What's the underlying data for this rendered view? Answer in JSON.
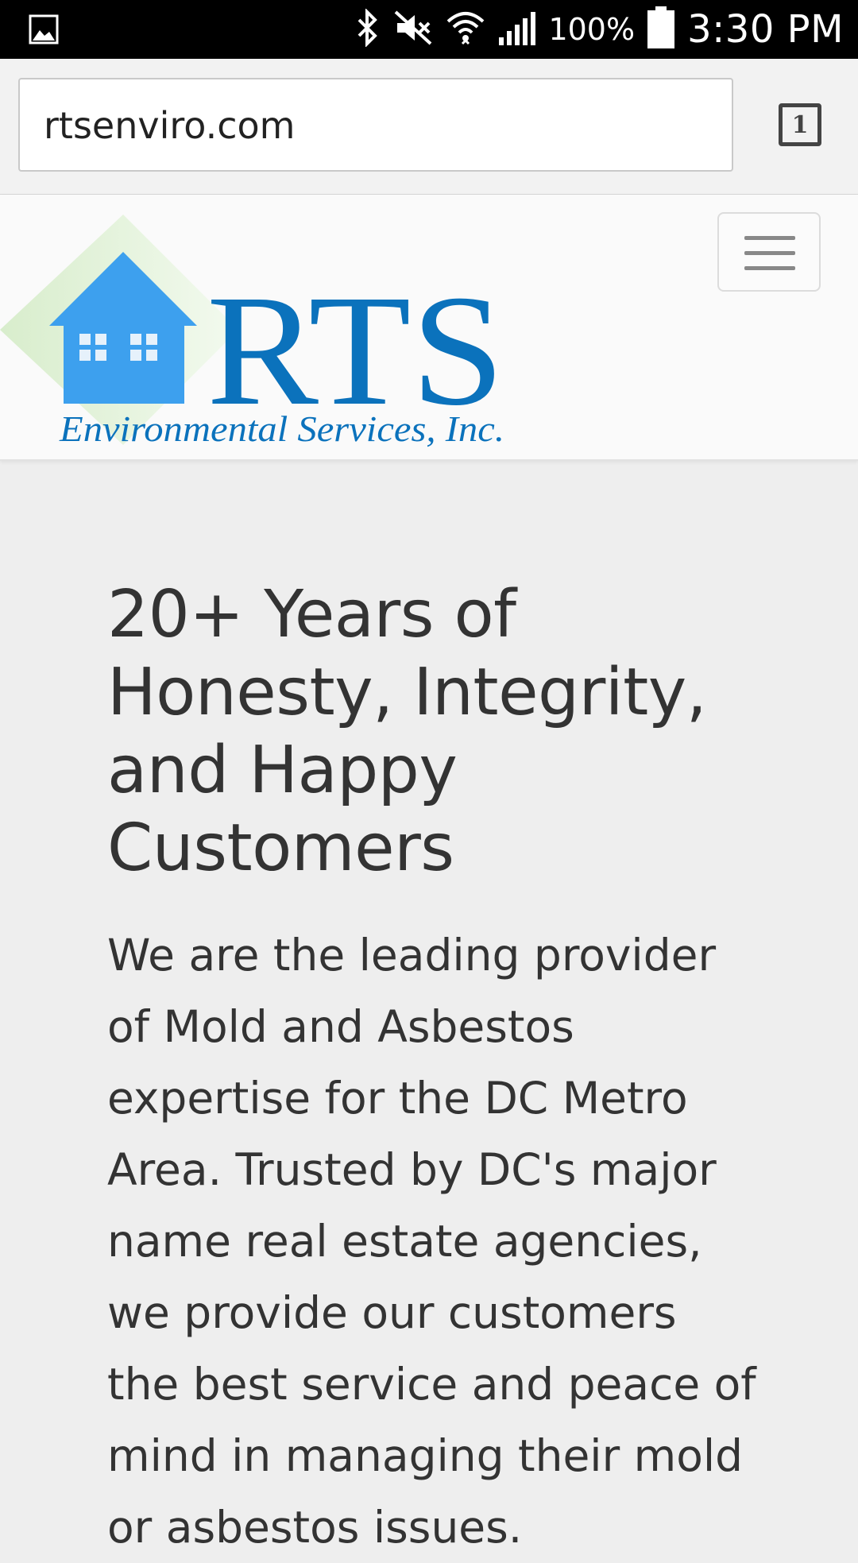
{
  "status_bar": {
    "icons": [
      "gallery-icon",
      "bluetooth-icon",
      "mute-icon",
      "wifi-icon",
      "signal-icon",
      "battery-icon"
    ],
    "battery": "100%",
    "time": "3:30 PM"
  },
  "browser": {
    "url": "rtsenviro.com",
    "tab_count": "1"
  },
  "site": {
    "logo": {
      "name": "RTS",
      "tagline": "Environmental Services, Inc."
    },
    "headline": "20+ Years of Honesty, Integrity, and Happy Customers",
    "body": "We are the leading provider of Mold and Asbestos expertise for the DC Metro Area. Trusted by DC's major name real estate agencies, we provide our customers the best service and peace of mind in managing their mold or asbestos issues."
  },
  "colors": {
    "logo_blue": "#0b72bc",
    "house_blue": "#3da0ee",
    "text": "#333333",
    "page_bg": "#eeeeee"
  }
}
